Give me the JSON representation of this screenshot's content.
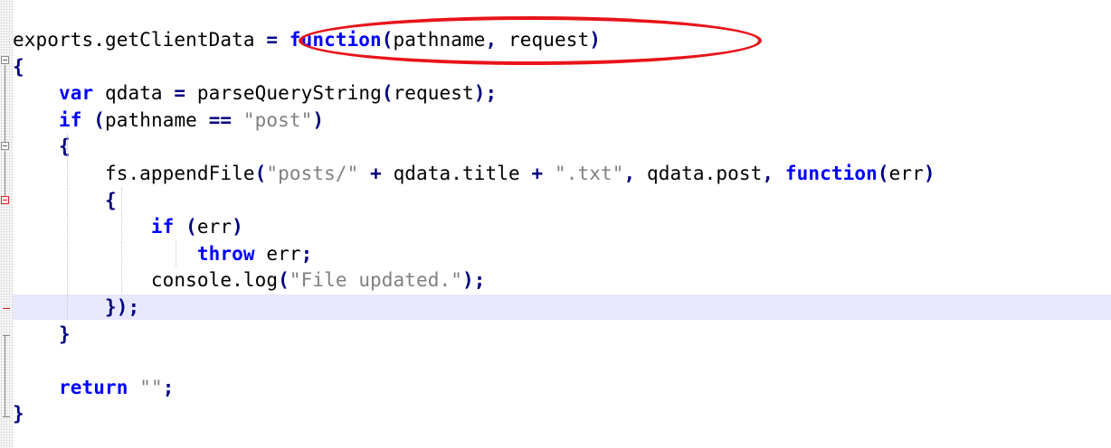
{
  "editor": {
    "language": "javascript",
    "lines": [
      {
        "tokens": [
          {
            "t": "exports.getClientData",
            "c": "id"
          },
          {
            "t": " = ",
            "c": "op"
          },
          {
            "t": "function",
            "c": "kw"
          },
          {
            "t": "(",
            "c": "op"
          },
          {
            "t": "pathname",
            "c": "id"
          },
          {
            "t": ", ",
            "c": "op"
          },
          {
            "t": "request",
            "c": "id"
          },
          {
            "t": ")",
            "c": "op"
          }
        ]
      },
      {
        "tokens": [
          {
            "t": "{",
            "c": "op"
          }
        ]
      },
      {
        "tokens": [
          {
            "t": "    "
          },
          {
            "t": "var",
            "c": "kw"
          },
          {
            "t": " qdata ",
            "c": "id"
          },
          {
            "t": "= ",
            "c": "op"
          },
          {
            "t": "parseQueryString",
            "c": "id"
          },
          {
            "t": "(",
            "c": "op"
          },
          {
            "t": "request",
            "c": "id"
          },
          {
            "t": ");",
            "c": "op"
          }
        ]
      },
      {
        "tokens": [
          {
            "t": "    "
          },
          {
            "t": "if",
            "c": "kw"
          },
          {
            "t": " (",
            "c": "op"
          },
          {
            "t": "pathname ",
            "c": "id"
          },
          {
            "t": "== ",
            "c": "op"
          },
          {
            "t": "\"post\"",
            "c": "str"
          },
          {
            "t": ")",
            "c": "op"
          }
        ]
      },
      {
        "tokens": [
          {
            "t": "    "
          },
          {
            "t": "{",
            "c": "op"
          }
        ]
      },
      {
        "tokens": [
          {
            "t": "        "
          },
          {
            "t": "fs.appendFile",
            "c": "id"
          },
          {
            "t": "(",
            "c": "op"
          },
          {
            "t": "\"posts/\"",
            "c": "str"
          },
          {
            "t": " + ",
            "c": "op"
          },
          {
            "t": "qdata.title ",
            "c": "id"
          },
          {
            "t": "+ ",
            "c": "op"
          },
          {
            "t": "\".txt\"",
            "c": "str"
          },
          {
            "t": ", ",
            "c": "op"
          },
          {
            "t": "qdata.post",
            "c": "id"
          },
          {
            "t": ", ",
            "c": "op"
          },
          {
            "t": "function",
            "c": "kw"
          },
          {
            "t": "(",
            "c": "op"
          },
          {
            "t": "err",
            "c": "id"
          },
          {
            "t": ")",
            "c": "op"
          }
        ]
      },
      {
        "tokens": [
          {
            "t": "        "
          },
          {
            "t": "{",
            "c": "op"
          }
        ]
      },
      {
        "tokens": [
          {
            "t": "            "
          },
          {
            "t": "if",
            "c": "kw"
          },
          {
            "t": " (",
            "c": "op"
          },
          {
            "t": "err",
            "c": "id"
          },
          {
            "t": ")",
            "c": "op"
          }
        ]
      },
      {
        "tokens": [
          {
            "t": "                "
          },
          {
            "t": "throw",
            "c": "kw"
          },
          {
            "t": " err",
            "c": "id"
          },
          {
            "t": ";",
            "c": "op"
          }
        ]
      },
      {
        "tokens": [
          {
            "t": "            "
          },
          {
            "t": "console.log",
            "c": "id"
          },
          {
            "t": "(",
            "c": "op"
          },
          {
            "t": "\"File updated.\"",
            "c": "str"
          },
          {
            "t": ");",
            "c": "op"
          }
        ]
      },
      {
        "tokens": [
          {
            "t": "        "
          },
          {
            "t": "});",
            "c": "op"
          }
        ],
        "current": true
      },
      {
        "tokens": [
          {
            "t": "    "
          },
          {
            "t": "}",
            "c": "op"
          }
        ]
      },
      {
        "tokens": []
      },
      {
        "tokens": [
          {
            "t": "    "
          },
          {
            "t": "return",
            "c": "kw"
          },
          {
            "t": " ",
            "c": "id"
          },
          {
            "t": "\"\"",
            "c": "str"
          },
          {
            "t": ";",
            "c": "op"
          }
        ]
      },
      {
        "tokens": [
          {
            "t": "}",
            "c": "op"
          }
        ]
      }
    ]
  },
  "annotation": {
    "shape": "ellipse",
    "color": "#e8141a"
  },
  "colors": {
    "keyword": "#0000ff",
    "operator": "#000080",
    "string": "#808080",
    "current_line": "#e8e8ff",
    "fold_marker_active": "#e0201a"
  }
}
